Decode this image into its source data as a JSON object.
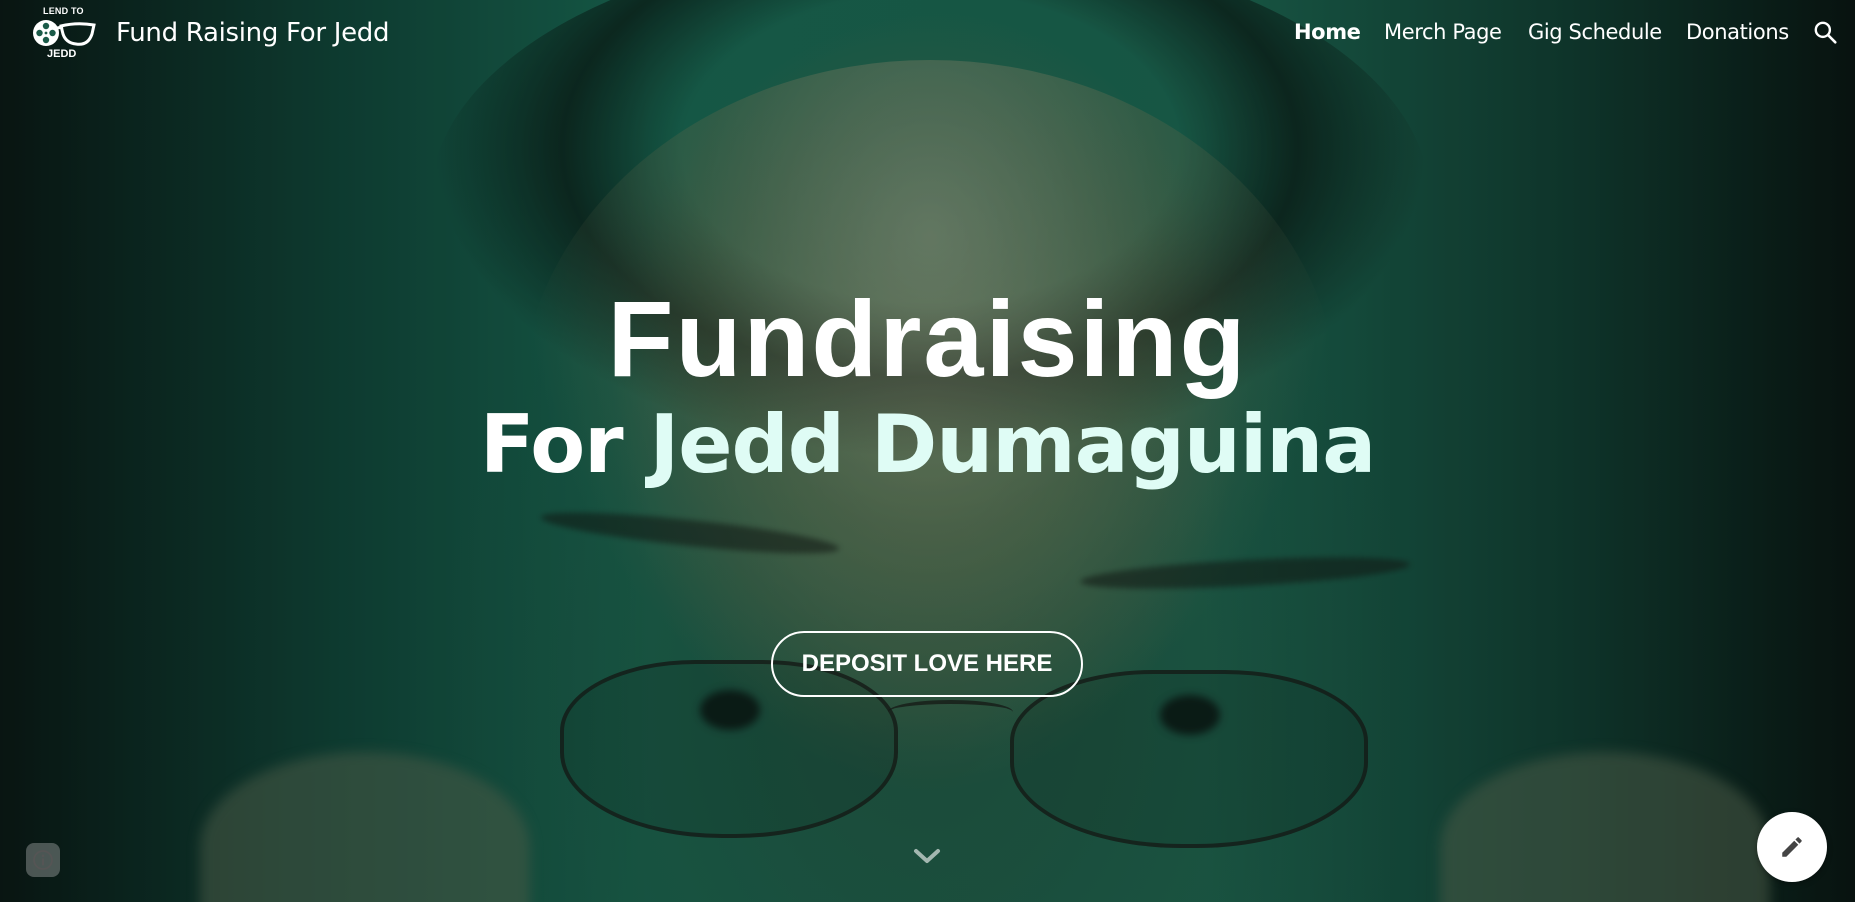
{
  "logo": {
    "top_text": "LEND TO",
    "bottom_text": "JEDD"
  },
  "site": {
    "title": "Fund Raising For Jedd"
  },
  "nav": {
    "items": [
      {
        "label": "Home",
        "active": true
      },
      {
        "label": "Merch Page",
        "active": false
      },
      {
        "label": "Gig Schedule",
        "active": false
      },
      {
        "label": "Donations",
        "active": false
      }
    ],
    "search_icon": "search-icon"
  },
  "hero": {
    "headline": "Fundraising",
    "subline_prefix": "For ",
    "subline_name": "Jedd Dumaguina",
    "cta_label": "DEPOSIT LOVE HERE",
    "scroll_icon": "chevron-down-icon"
  },
  "footer": {
    "info_icon": "info-icon",
    "edit_icon": "pencil-icon"
  },
  "colors": {
    "text": "#ffffff",
    "name_accent": "#dffcf5",
    "background_green": "#1a6b55"
  }
}
